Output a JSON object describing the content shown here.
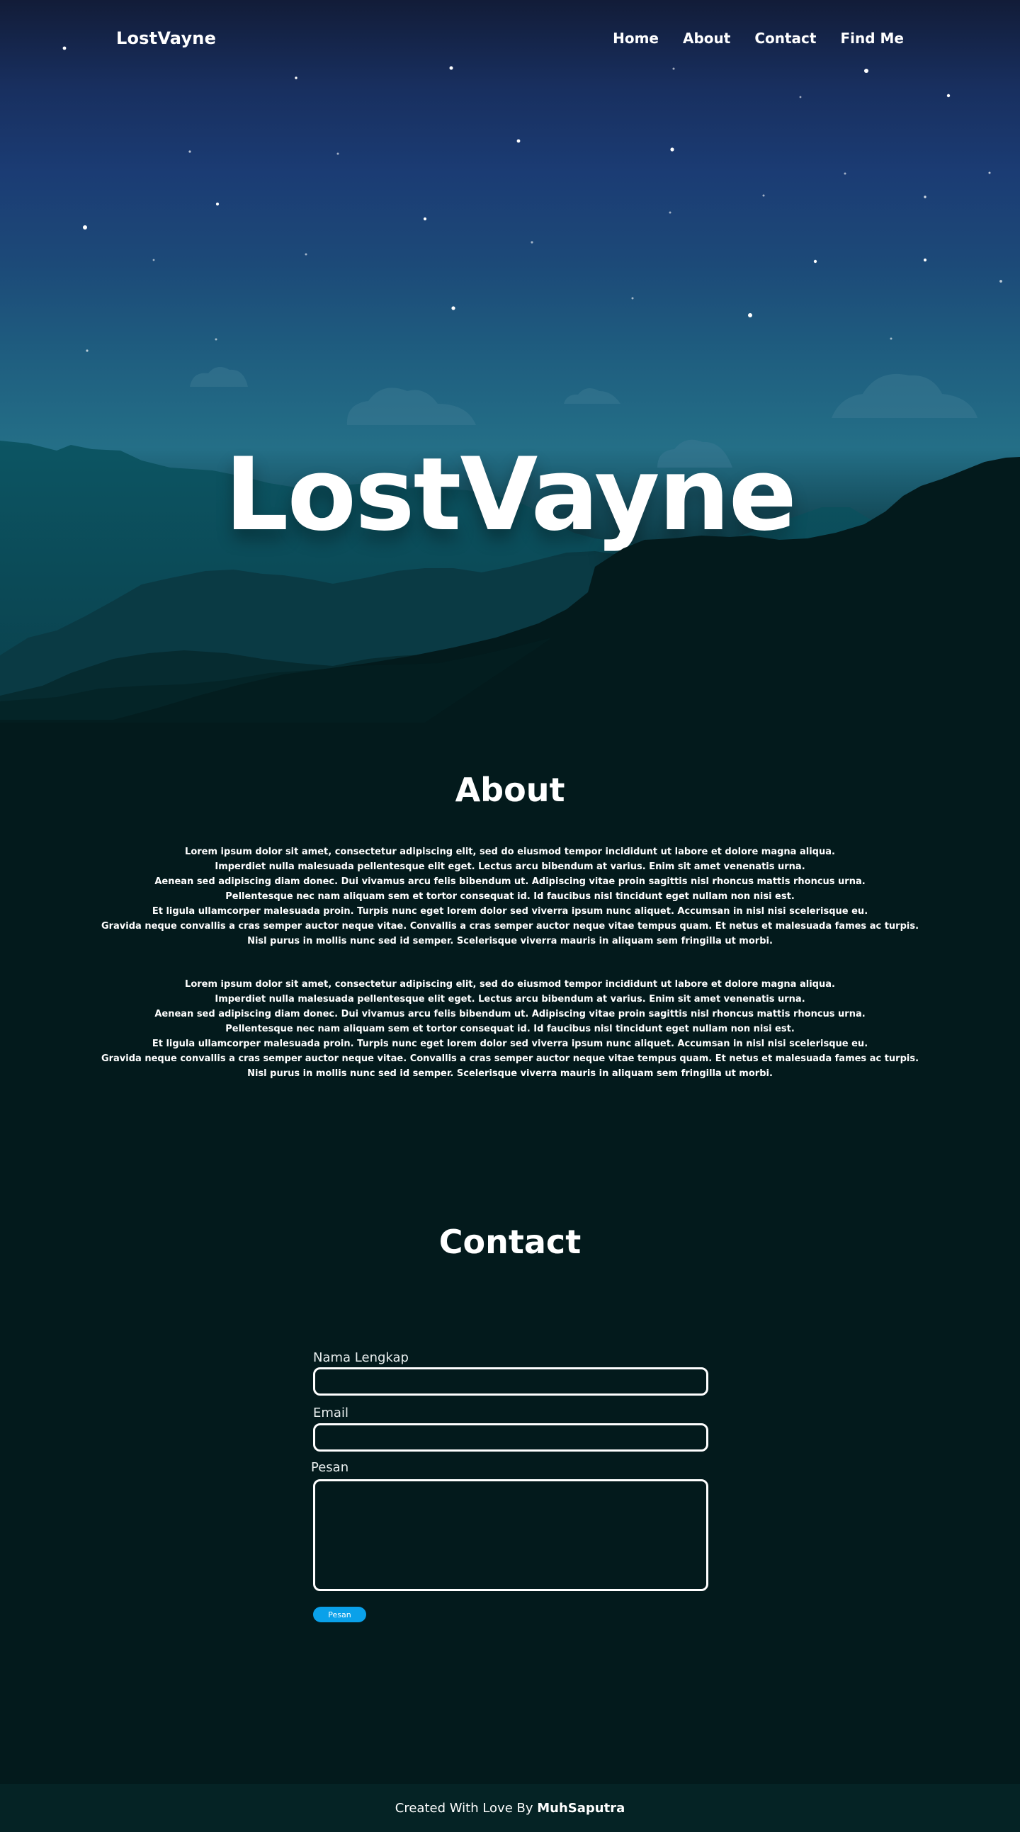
{
  "colors": {
    "sky_top": "#121c38",
    "sky_bottom": "#246f87",
    "mountain_dark": "#031a1c",
    "accent_button": "#0aa1ea",
    "footer_bg": "#052325"
  },
  "navbar": {
    "brand": "LostVayne",
    "links": [
      {
        "label": "Home"
      },
      {
        "label": "About"
      },
      {
        "label": "Contact"
      },
      {
        "label": "Find Me"
      }
    ]
  },
  "hero": {
    "title": "LostVayne"
  },
  "about": {
    "title": "About",
    "paragraphs": [
      {
        "lines": [
          "Lorem ipsum dolor sit amet, consectetur adipiscing elit, sed do eiusmod tempor incididunt ut labore et dolore magna aliqua.",
          "Imperdiet nulla malesuada pellentesque elit eget. Lectus arcu bibendum at varius. Enim sit amet venenatis urna.",
          "Aenean sed adipiscing diam donec. Dui vivamus arcu felis bibendum ut. Adipiscing vitae proin sagittis nisl rhoncus mattis rhoncus urna.",
          "Pellentesque nec nam aliquam sem et tortor consequat id. Id faucibus nisl tincidunt eget nullam non nisi est.",
          "Et ligula ullamcorper malesuada proin. Turpis nunc eget lorem dolor sed viverra ipsum nunc aliquet. Accumsan in nisl nisi scelerisque eu.",
          "Gravida neque convallis a cras semper auctor neque vitae. Convallis a cras semper auctor neque vitae tempus quam. Et netus et malesuada fames ac turpis.",
          "Nisl purus in mollis nunc sed id semper. Scelerisque viverra mauris in aliquam sem fringilla ut morbi."
        ]
      },
      {
        "lines": [
          "Lorem ipsum dolor sit amet, consectetur adipiscing elit, sed do eiusmod tempor incididunt ut labore et dolore magna aliqua.",
          "Imperdiet nulla malesuada pellentesque elit eget. Lectus arcu bibendum at varius. Enim sit amet venenatis urna.",
          "Aenean sed adipiscing diam donec. Dui vivamus arcu felis bibendum ut. Adipiscing vitae proin sagittis nisl rhoncus mattis rhoncus urna.",
          "Pellentesque nec nam aliquam sem et tortor consequat id. Id faucibus nisl tincidunt eget nullam non nisi est.",
          "Et ligula ullamcorper malesuada proin. Turpis nunc eget lorem dolor sed viverra ipsum nunc aliquet. Accumsan in nisl nisi scelerisque eu.",
          "Gravida neque convallis a cras semper auctor neque vitae. Convallis a cras semper auctor neque vitae tempus quam. Et netus et malesuada fames ac turpis.",
          "Nisl purus in mollis nunc sed id semper. Scelerisque viverra mauris in aliquam sem fringilla ut morbi."
        ]
      }
    ]
  },
  "contact": {
    "title": "Contact",
    "name_label": "Nama Lengkap",
    "name_value": "",
    "email_label": "Email",
    "email_value": "",
    "message_label": "Pesan",
    "message_value": "",
    "submit_label": "Pesan"
  },
  "footer": {
    "prefix": "Created With Love By ",
    "author": "MuhSaputra"
  }
}
